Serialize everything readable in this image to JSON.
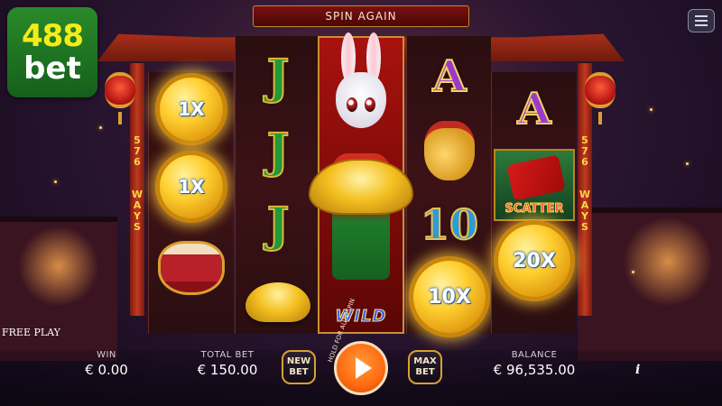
{
  "logo": {
    "line1": "488",
    "line2": "bet"
  },
  "header": {
    "banner": "SPIN AGAIN"
  },
  "sides": {
    "left_text": "576 WAYS",
    "right_text": "576 WAYS"
  },
  "reels": {
    "reel1": [
      "1X",
      "1X",
      "drum"
    ],
    "reel2": [
      "J",
      "J",
      "J",
      "ingot"
    ],
    "reel3": [
      "rabbit-wild"
    ],
    "reel4": [
      "A",
      "gold-bag",
      "10",
      "10X"
    ],
    "reel5": [
      "A",
      "scatter",
      "20X"
    ]
  },
  "symbols": {
    "coin_reel1_top": "1X",
    "coin_reel1_mid": "1X",
    "coin_reel4_bottom": "10X",
    "coin_reel5_bottom": "20X",
    "letter_j": "J",
    "letter_a": "A",
    "ten": "10",
    "scatter": "SCATTER",
    "wild": "WILD"
  },
  "footer": {
    "mode": "FREE PLAY",
    "win_label": "WIN",
    "win_value": "€ 0.00",
    "total_bet_label": "TOTAL BET",
    "total_bet_value": "€ 150.00",
    "new_bet_label": "NEW BET",
    "autospin_hint": "HOLD FOR AUTOSPIN",
    "max_bet_label": "MAX BET",
    "balance_label": "BALANCE",
    "balance_value": "€ 96,535.00",
    "info_glyph": "i"
  },
  "icons": [
    "menu-icon",
    "play-icon",
    "info-icon",
    "lantern-icon"
  ],
  "colors": {
    "spin_orange": "#ff6a10",
    "gold": "#d9a030",
    "brand_green": "#1f7a22",
    "brand_yellow": "#f4ec1a"
  }
}
